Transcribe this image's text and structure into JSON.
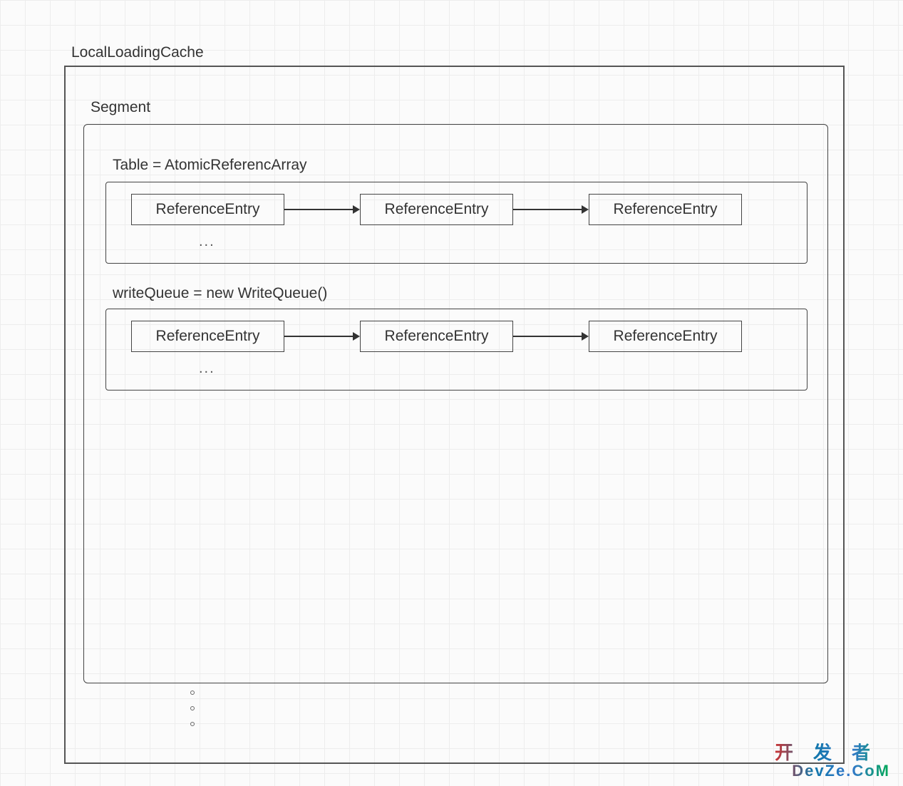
{
  "outerLabel": "LocalLoadingCache",
  "segmentLabel": "Segment",
  "sections": {
    "table": {
      "label": "Table = AtomicReferencArray",
      "entries": [
        "ReferenceEntry",
        "ReferenceEntry",
        "ReferenceEntry"
      ],
      "ellipsis": "..."
    },
    "queue": {
      "label": "writeQueue = new WriteQueue()",
      "entries": [
        "ReferenceEntry",
        "ReferenceEntry",
        "ReferenceEntry"
      ],
      "ellipsis": "..."
    }
  },
  "watermark": {
    "line1": "开发者",
    "line2": "DevZe.CoM"
  }
}
